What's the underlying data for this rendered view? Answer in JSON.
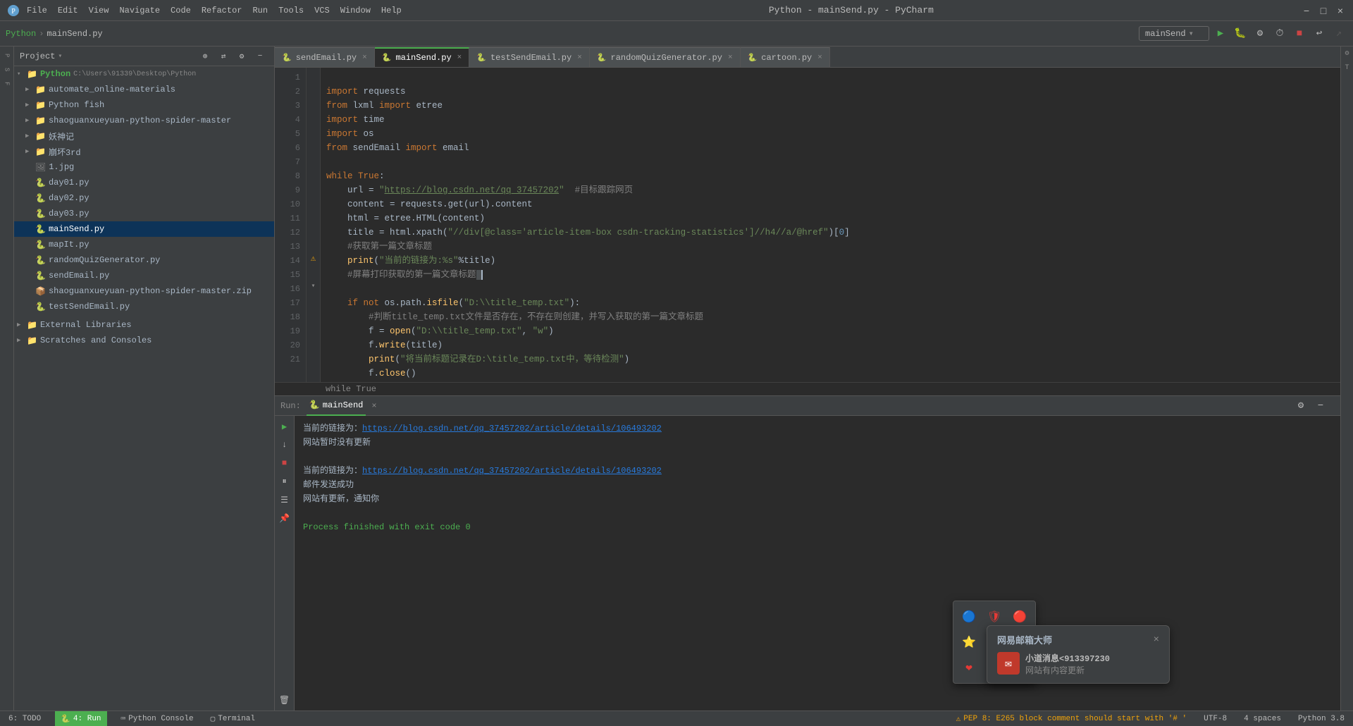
{
  "titleBar": {
    "title": "Python - mainSend.py - PyCharm",
    "menus": [
      "File",
      "Edit",
      "View",
      "Navigate",
      "Code",
      "Refactor",
      "Run",
      "Tools",
      "VCS",
      "Window",
      "Help"
    ],
    "buttons": [
      "−",
      "□",
      "×"
    ]
  },
  "breadcrumb": {
    "root": "Python",
    "file": "mainSend.py"
  },
  "runConfig": {
    "name": "mainSend",
    "label": "mainSend"
  },
  "projectPanel": {
    "title": "Project",
    "root": {
      "name": "Python",
      "path": "C:\\Users\\91339\\Desktop\\Python",
      "children": [
        {
          "name": "automate_online-materials",
          "type": "folder",
          "indent": 1
        },
        {
          "name": "Python fish",
          "type": "folder",
          "indent": 1
        },
        {
          "name": "shaoguanxueyuan-python-spider-master",
          "type": "folder",
          "indent": 1
        },
        {
          "name": "妖神记",
          "type": "folder",
          "indent": 1
        },
        {
          "name": "崩坏3rd",
          "type": "folder",
          "indent": 1
        },
        {
          "name": "1.jpg",
          "type": "file",
          "indent": 1
        },
        {
          "name": "day01.py",
          "type": "py",
          "indent": 1
        },
        {
          "name": "day02.py",
          "type": "py",
          "indent": 1
        },
        {
          "name": "day03.py",
          "type": "py",
          "indent": 1
        },
        {
          "name": "mainSend.py",
          "type": "py",
          "indent": 1,
          "active": true
        },
        {
          "name": "mapIt.py",
          "type": "py",
          "indent": 1
        },
        {
          "name": "randomQuizGenerator.py",
          "type": "py",
          "indent": 1
        },
        {
          "name": "sendEmail.py",
          "type": "py",
          "indent": 1
        },
        {
          "name": "shaoguanxueyuan-python-spider-master.zip",
          "type": "zip",
          "indent": 1
        },
        {
          "name": "testSendEmail.py",
          "type": "py",
          "indent": 1
        }
      ]
    },
    "external": "External Libraries",
    "scratches": "Scratches and Consoles"
  },
  "tabs": [
    {
      "name": "sendEmail.py",
      "active": false,
      "icon": "py"
    },
    {
      "name": "mainSend.py",
      "active": true,
      "icon": "py"
    },
    {
      "name": "testSendEmail.py",
      "active": false,
      "icon": "py"
    },
    {
      "name": "randomQuizGenerator.py",
      "active": false,
      "icon": "py"
    },
    {
      "name": "cartoon.py",
      "active": false,
      "icon": "py"
    }
  ],
  "codeLines": [
    {
      "num": 1,
      "code": "import requests"
    },
    {
      "num": 2,
      "code": "from lxml import etree"
    },
    {
      "num": 3,
      "code": "import time"
    },
    {
      "num": 4,
      "code": "import os"
    },
    {
      "num": 5,
      "code": "from sendEmail import email"
    },
    {
      "num": 6,
      "code": ""
    },
    {
      "num": 7,
      "code": "while True:"
    },
    {
      "num": 8,
      "code": "    url = \"https://blog.csdn.net/qq_37457202\"  #目标跟踪网页"
    },
    {
      "num": 9,
      "code": "    content = requests.get(url).content"
    },
    {
      "num": 10,
      "code": "    html = etree.HTML(content)"
    },
    {
      "num": 11,
      "code": "    title = html.xpath(\"//div[@class='article-item-box csdn-tracking-statistics']//h4//a/@href\")[0]"
    },
    {
      "num": 12,
      "code": "    #获取第一篇文章标题"
    },
    {
      "num": 13,
      "code": "    print(\"当前的链接为:%s\"%title)"
    },
    {
      "num": 14,
      "code": "    #屏幕打印获取的第一篇文章标题"
    },
    {
      "num": 15,
      "code": ""
    },
    {
      "num": 16,
      "code": "    if not os.path.isfile(\"D:\\\\title_temp.txt\"):"
    },
    {
      "num": 17,
      "code": "        #判断title_temp.txt文件是否存在，不存在则创建，并写入获取的第一篇文章标题"
    },
    {
      "num": 18,
      "code": "        f = open(\"D:\\\\title_temp.txt\", \"w\")"
    },
    {
      "num": 19,
      "code": "        f.write(title)"
    },
    {
      "num": 20,
      "code": "        print(\"将当前标题记录在D:\\title_temp.txt中，等待检测\")"
    },
    {
      "num": 21,
      "code": "        f.close()"
    }
  ],
  "folded": "while True",
  "runPanel": {
    "label": "Run:",
    "tab": "mainSend",
    "output": [
      {
        "type": "text",
        "content": "当前的链接为："
      },
      {
        "type": "link",
        "content": "https://blog.csdn.net/qq_37457202/article/details/106493202"
      },
      {
        "type": "text",
        "content": "网站暂时没有更新"
      },
      {
        "type": "blank"
      },
      {
        "type": "text",
        "content": "当前的链接为："
      },
      {
        "type": "link",
        "content": "https://blog.csdn.net/qq_37457202/article/details/106493202"
      },
      {
        "type": "text",
        "content": "邮件发送成功"
      },
      {
        "type": "text",
        "content": "网站有更新，通知你"
      },
      {
        "type": "blank"
      },
      {
        "type": "process",
        "content": "Process finished with exit code 0"
      }
    ]
  },
  "statusBar": {
    "todo": "6: TODO",
    "run": "4: Run",
    "pythonConsole": "Python Console",
    "terminal": "Terminal",
    "encoding": "UTF-8",
    "lineEnding": "4 spaces",
    "pythonVersion": "Python 3.8",
    "warning": "PEP 8: E265 block comment should start with '# '"
  },
  "notification": {
    "title": "网易邮箱大师",
    "sender": "小道消息<913397230",
    "content": "网站有内容更新",
    "closeLabel": "×"
  },
  "trayIcons": [
    "🔵",
    "🔴",
    "🔴",
    "🟡",
    "🔍",
    "🔵",
    "🔴",
    "🟡",
    "🌐"
  ]
}
